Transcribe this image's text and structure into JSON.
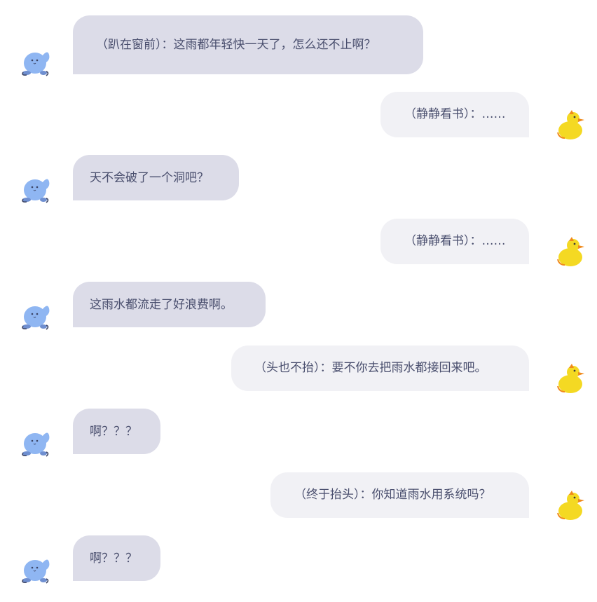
{
  "icons": {
    "left_avatar": "blue-seal-avatar-icon",
    "right_avatar": "yellow-duck-avatar-icon"
  },
  "colors": {
    "left_bubble": "#dcdce8",
    "right_bubble": "#f1f1f5",
    "text": "#4a4f6e",
    "seal": "#8fb6f2",
    "duck": "#f4d923"
  },
  "messages": [
    {
      "side": "left",
      "text": "（趴在窗前）：这雨都年轻快一天了，怎么还不止啊？"
    },
    {
      "side": "right",
      "text": "（静静看书）：……"
    },
    {
      "side": "left",
      "text": "天不会破了一个洞吧？"
    },
    {
      "side": "right",
      "text": "（静静看书）：……"
    },
    {
      "side": "left",
      "text": "这雨水都流走了好浪费啊。"
    },
    {
      "side": "right",
      "text": "（头也不抬）：要不你去把雨水都接回来吧。"
    },
    {
      "side": "left",
      "text": "啊？？？"
    },
    {
      "side": "right",
      "text": "（终于抬头）：你知道雨水用系统吗？"
    },
    {
      "side": "left",
      "text": "啊？？？"
    }
  ]
}
